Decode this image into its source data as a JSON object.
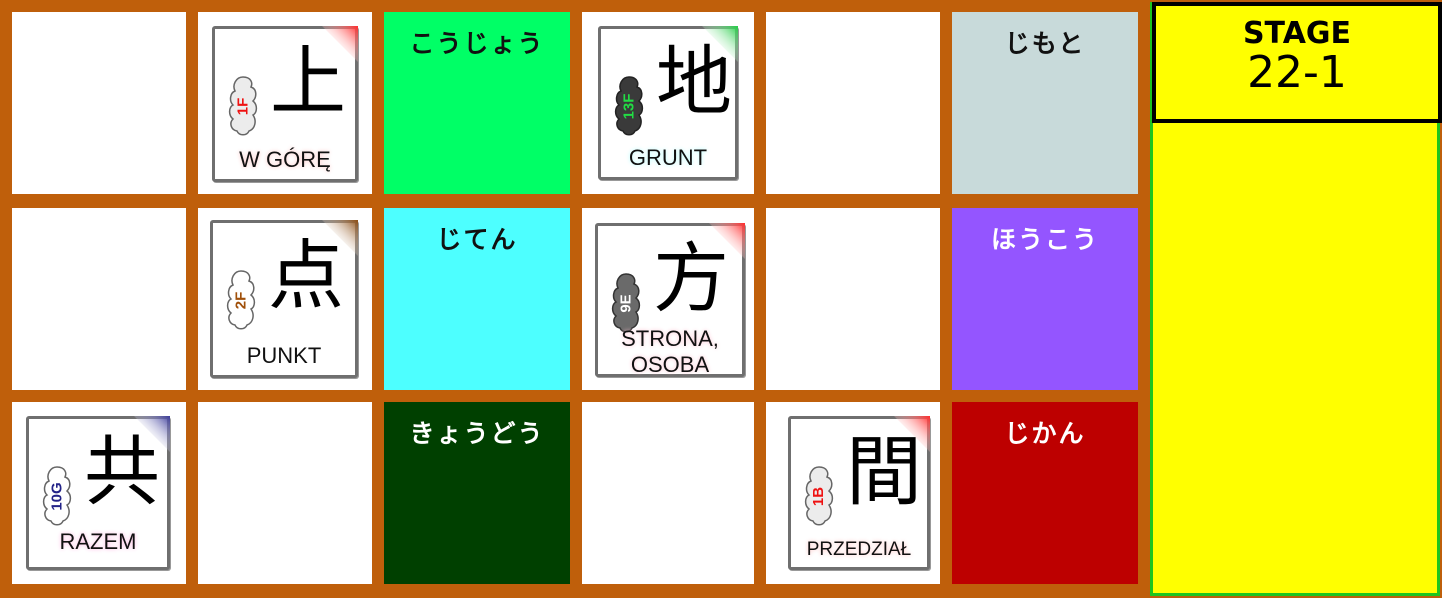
{
  "stage": {
    "label": "STAGE",
    "number": "22-1"
  },
  "words": {
    "koujou": "こうじょう",
    "jimoto": "じもと",
    "jiten": "じてん",
    "houkou": "ほうこう",
    "kyoudou": "きょうどう",
    "jikan": "じかん"
  },
  "cards": {
    "ue": {
      "kanji": "上",
      "code": "1F",
      "meaning": "W GÓRĘ"
    },
    "chi": {
      "kanji": "地",
      "code": "13F",
      "meaning": "GRUNT"
    },
    "ten": {
      "kanji": "点",
      "code": "2F",
      "meaning": "PUNKT"
    },
    "hou": {
      "kanji": "方",
      "code": "9E",
      "meaning1": "STRONA,",
      "meaning2": "OSOBA"
    },
    "tomo": {
      "kanji": "共",
      "code": "10G",
      "meaning": "RAZEM"
    },
    "aida": {
      "kanji": "間",
      "code": "1B",
      "meaning": "PRZEDZIAŁ"
    }
  },
  "colors": {
    "board_brown": "#bf5f0b",
    "koujou": "#00ff66",
    "jimoto": "#c8dada",
    "jiten": "#4dffff",
    "houkou": "#9455ff",
    "kyoudou": "#004000",
    "jikan": "#bd0000",
    "panel": "#ffff00"
  }
}
